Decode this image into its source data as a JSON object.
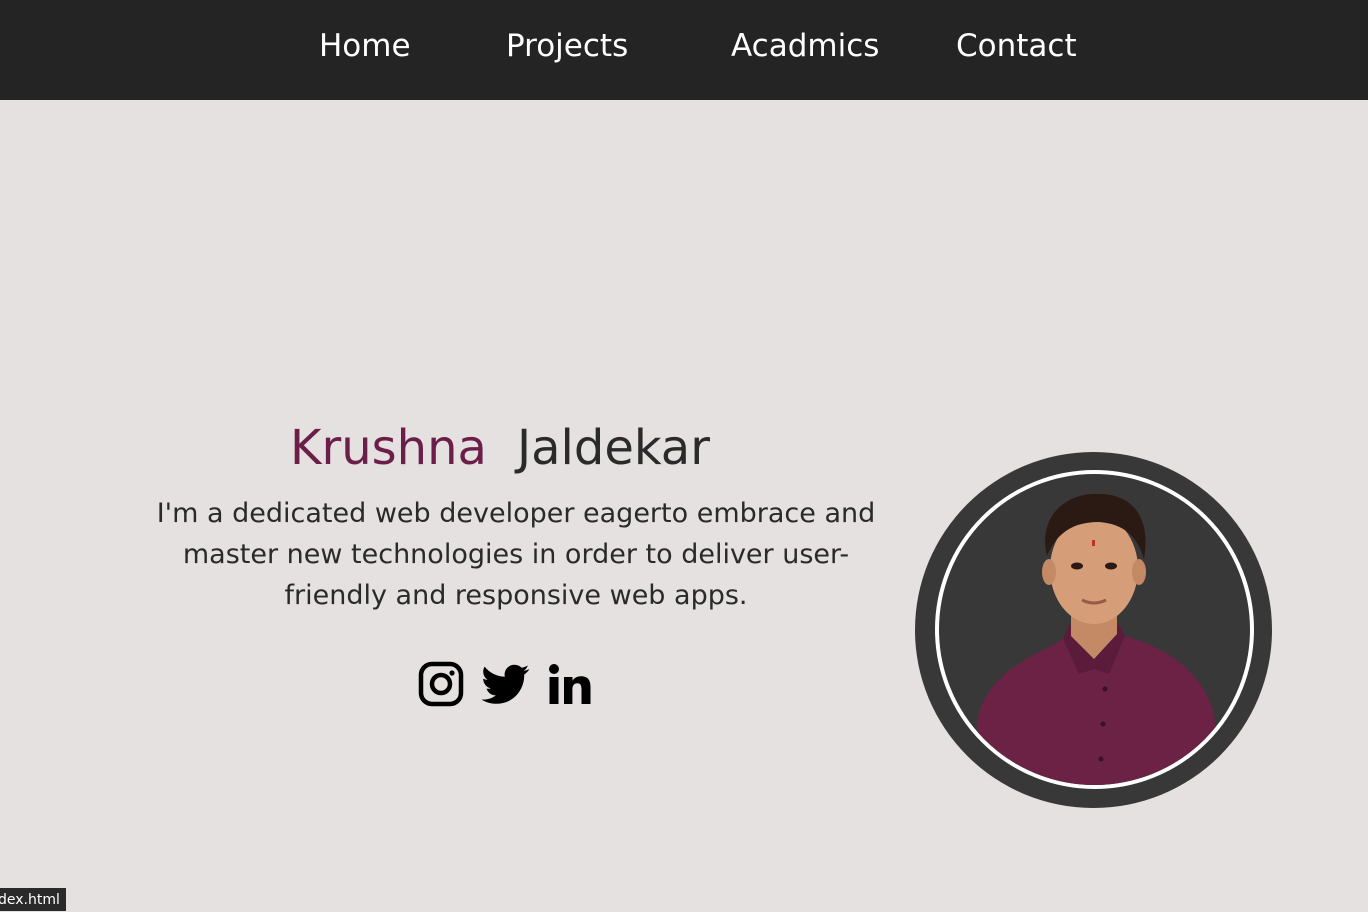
{
  "nav": {
    "items": [
      {
        "label": "Home"
      },
      {
        "label": "Projects"
      },
      {
        "label": "Acadmics"
      },
      {
        "label": "Contact"
      }
    ]
  },
  "hero": {
    "first_name": "Krushna",
    "last_name": "Jaldekar",
    "bio": "I'm a dedicated web developer eagerto embrace and master new technologies in order to deliver user-friendly and responsive web apps.",
    "socials": [
      {
        "icon": "instagram-icon"
      },
      {
        "icon": "twitter-icon"
      },
      {
        "icon": "linkedin-icon"
      }
    ]
  },
  "status_bar": {
    "text": "dex.html"
  },
  "colors": {
    "nav_bg": "#252425",
    "page_bg": "#e4e1e0",
    "first_name": "#6a1e48",
    "photo_ring": "#393838"
  }
}
